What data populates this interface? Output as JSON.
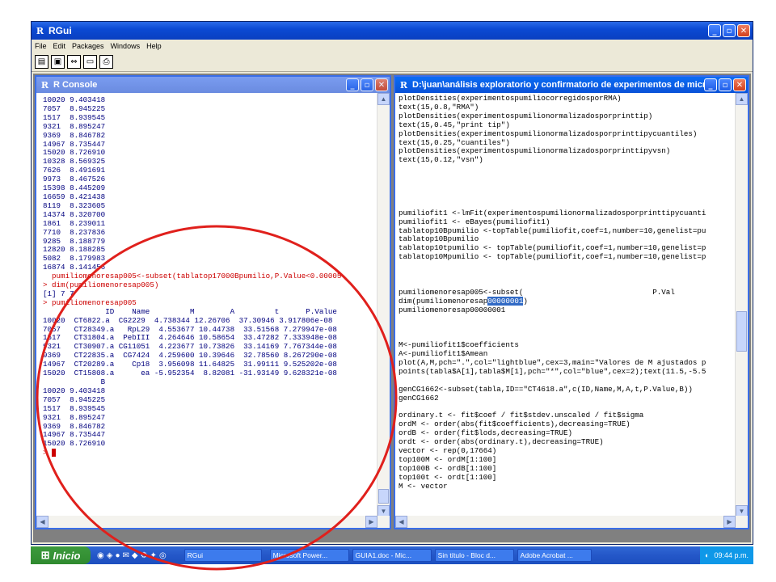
{
  "app": {
    "title": "RGui"
  },
  "menu": [
    "File",
    "Edit",
    "Packages",
    "Windows",
    "Help"
  ],
  "toolbar_icons": [
    "open-script-icon",
    "save-icon",
    "copy-paste-icon",
    "console-icon",
    "print-icon"
  ],
  "console": {
    "title": "R Console",
    "lines": [
      {
        "t": "10020 9.403418"
      },
      {
        "t": "7057  8.945225"
      },
      {
        "t": "1517  8.939545"
      },
      {
        "t": "9321  8.895247"
      },
      {
        "t": "9369  8.846782"
      },
      {
        "t": "14967 8.735447"
      },
      {
        "t": "15020 8.726910"
      },
      {
        "t": "10328 8.569325"
      },
      {
        "t": "7626  8.491691"
      },
      {
        "t": "9973  8.467526"
      },
      {
        "t": "15398 8.445209"
      },
      {
        "t": "16659 8.421438"
      },
      {
        "t": "8119  8.323605"
      },
      {
        "t": "14374 8.320700"
      },
      {
        "t": "1861  8.239011"
      },
      {
        "t": "7710  8.237836"
      },
      {
        "t": "9285  8.188779"
      },
      {
        "t": "12820 8.188285"
      },
      {
        "t": "5082  8.179983"
      },
      {
        "t": "16874 8.141456"
      },
      {
        "t": "  pumiliomenoresap005<-subset(tablatop17000Bpumilio,P.Value<0.00005",
        "c": "red"
      },
      {
        "t": "> dim(pumiliomenoresap005)",
        "c": "red"
      },
      {
        "t": "[1] 7 7"
      },
      {
        "t": "> pumiliomenoresap005",
        "c": "red"
      },
      {
        "t": "              ID    Name         M        A         t      P.Value"
      },
      {
        "t": "10020  CT6822.a  CG2229  4.738344 12.26706  37.30946 3.917806e-08"
      },
      {
        "t": "7057   CT28349.a   RpL29  4.553677 10.44738  33.51568 7.279947e-08"
      },
      {
        "t": "1517   CT31804.a  PebIII  4.264646 10.58654  33.47282 7.333948e-08"
      },
      {
        "t": "9321   CT30907.a CG11051  4.223677 10.73826  33.14169 7.767344e-08"
      },
      {
        "t": "9369   CT22835.a  CG7424  4.259600 10.39646  32.78560 8.267290e-08"
      },
      {
        "t": "14967  CT20289.a    Cp18  3.956098 11.64825  31.99111 9.525202e-08"
      },
      {
        "t": "15020  CT15808.a      ea -5.952354  8.82081 -31.93149 9.628321e-08"
      },
      {
        "t": "             B"
      },
      {
        "t": "10020 9.403418"
      },
      {
        "t": "7057  8.945225"
      },
      {
        "t": "1517  8.939545"
      },
      {
        "t": "9321  8.895247"
      },
      {
        "t": "9369  8.846782"
      },
      {
        "t": "14967 8.735447"
      },
      {
        "t": "15020 8.726910"
      },
      {
        "t": "> ",
        "c": "red"
      }
    ]
  },
  "editor": {
    "title": "D:\\juan\\análisis exploratorio y confirmatorio de experimentos de microarr...",
    "lines": [
      "plotDensities(experimentospumiliocorregidosporRMA)",
      "text(15,0.8,\"RMA\")",
      "plotDensities(experimentospumilionormalizadosporprinttip)",
      "text(15,0.45,\"print tip\")",
      "plotDensities(experimentospumilionormalizadosporprinttipycuantiles)",
      "text(15,0.25,\"cuantiles\")",
      "plotDensities(experimentospumilionormalizadosporprinttipyvsn)",
      "text(15,0.12,\"vsn\")",
      "",
      "",
      "",
      "",
      "",
      "pumiliofit1 <-lmFit(experimentospumilionormalizadosporprinttipycuanti",
      "pumiliofit1 <- eBayes(pumiliofit1)",
      "tablatop10Bpumilio <-topTable(pumiliofit,coef=1,number=10,genelist=pu",
      "tablatop10Bpumilio",
      "tablatop10tpumilio <- topTable(pumiliofit,coef=1,number=10,genelist=p",
      "tablatop10Mpumilio <- topTable(pumiliofit,coef=1,number=10,genelist=p",
      "",
      "",
      "",
      "pumiliomenoresap005<-subset(                             P.Val",
      "dim(pumiliomenoresap00000001)",
      "pumiliomenoresap00000001",
      "",
      "",
      "",
      "M<-pumiliofit1$coefficients",
      "A<-pumiliofit1$Amean",
      "plot(A,M,pch=\".\",col=\"lightblue\",cex=3,main=\"Valores de M ajustados p",
      "points(tabla$A[1],tabla$M[1],pch=\"*\",col=\"blue\",cex=2);text(11.5,-5.5",
      "",
      "genCG1662<-subset(tabla,ID==\"CT4618.a\",c(ID,Name,M,A,t,P.Value,B))",
      "genCG1662",
      "",
      "ordinary.t <- fit$coef / fit$stdev.unscaled / fit$sigma",
      "ordM <- order(abs(fit$coefficients),decreasing=TRUE)",
      "ordB <- order(fit$lods,decreasing=TRUE)",
      "ordt <- order(abs(ordinary.t),decreasing=TRUE)",
      "vector <- rep(0,17664)",
      "top100M <- ordM[1:100]",
      "top100B <- ordB[1:100]",
      "top100t <- ordt[1:100]",
      "M <- vector"
    ],
    "selected_text": "00000001"
  },
  "taskbar": {
    "start": "Inicio",
    "tasks": [
      "RGui",
      "Microsoft Power...",
      "GUIA1.doc - Mic...",
      "Sin título - Bloc d...",
      "Adobe Acrobat ..."
    ],
    "clock": "09:44 p.m."
  },
  "annotation_color": "#e0201c"
}
